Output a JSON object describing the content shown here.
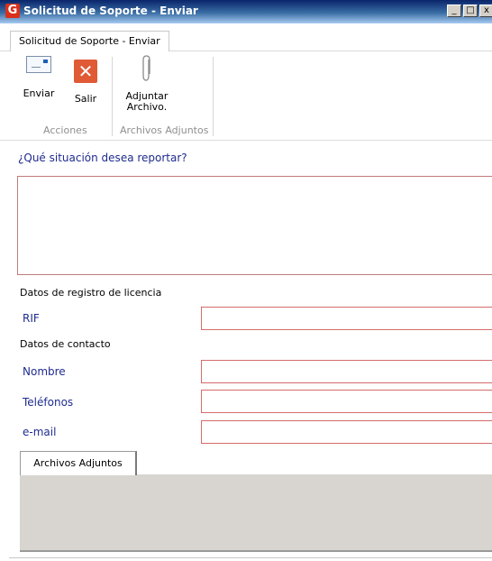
{
  "window": {
    "title": "Solicitud de Soporte - Enviar",
    "logo_letter": "G",
    "controls": {
      "minimize": "_",
      "maximize": "□",
      "close": "x"
    }
  },
  "tab": {
    "label": "Solicitud de Soporte - Enviar"
  },
  "ribbon": {
    "groups": [
      {
        "label": "Acciones",
        "buttons": [
          {
            "label": "Enviar",
            "icon": "envelope-icon"
          },
          {
            "label": "Salir",
            "icon": "close-x-icon"
          }
        ]
      },
      {
        "label": "Archivos Adjuntos",
        "buttons": [
          {
            "label": "Adjuntar\nArchivo.",
            "icon": "paperclip-icon"
          }
        ]
      }
    ],
    "enviar": "Enviar",
    "salir": "Salir",
    "adjuntar_line1": "Adjuntar",
    "adjuntar_line2": "Archivo.",
    "group1": "Acciones",
    "group2": "Archivos Adjuntos"
  },
  "form": {
    "question": "¿Qué  situación desea reportar?",
    "description_value": "",
    "section_license": "Datos de registro de licencia",
    "rif_label": "RIF",
    "rif_value": "",
    "section_contact": "Datos de contacto",
    "nombre_label": "Nombre",
    "nombre_value": "",
    "telefonos_label": "Teléfonos",
    "telefonos_value": "",
    "email_label": "e-mail",
    "email_value": ""
  },
  "attachments": {
    "tab_label": "Archivos Adjuntos"
  },
  "colors": {
    "label_blue": "#1f2b8f",
    "field_border": "#d56b6b",
    "salir_red": "#e05a36",
    "logo_red": "#d9301c"
  }
}
